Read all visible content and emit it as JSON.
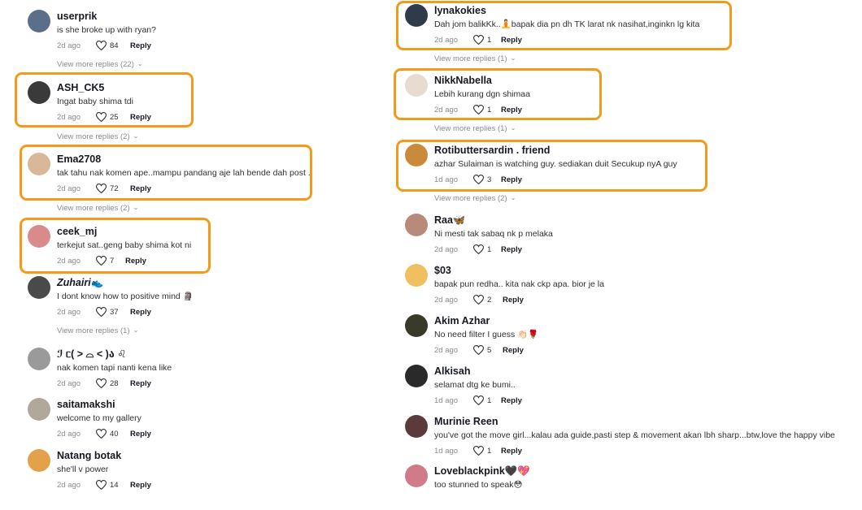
{
  "colors": {
    "highlight": "#f39a1c",
    "muted": "#8a8b91",
    "text": "#161823"
  },
  "left": {
    "comments": [
      {
        "user": "userprik",
        "text": "is she broke up with ryan?",
        "time": "2d ago",
        "likes": "84",
        "reply": "Reply",
        "avatar": "#5b6f8a"
      },
      {
        "user": "ASH_CK5",
        "text": "Ingat baby shima tdi",
        "time": "2d ago",
        "likes": "25",
        "reply": "Reply",
        "avatar": "#3a3a3a"
      },
      {
        "user": "Ema2708",
        "text": "tak tahu nak komen ape..mampu pandang aje lah bende dah post .",
        "time": "2d ago",
        "likes": "72",
        "reply": "Reply",
        "avatar": "#d9b89a"
      },
      {
        "user": "ceek_mj",
        "text": "terkejut sat..geng baby shima kot ni",
        "time": "2d ago",
        "likes": "7",
        "reply": "Reply",
        "avatar": "#d98a8a"
      },
      {
        "user": "Zuhairi👟",
        "text": "I dont know how to positive mind 🗿",
        "time": "2d ago",
        "likes": "37",
        "reply": "Reply",
        "avatar": "#4a4a4a"
      },
      {
        "user": "ℐ ᥴ( > ⌓ < )ა ♌",
        "text": "nak komen tapi nanti kena like",
        "time": "2d ago",
        "likes": "28",
        "reply": "Reply",
        "avatar": "#9a9a9a"
      },
      {
        "user": "saitamakshi",
        "text": "welcome to my gallery",
        "time": "2d ago",
        "likes": "40",
        "reply": "Reply",
        "avatar": "#b0a89a"
      },
      {
        "user": "Natang botak",
        "text": "she'll v power",
        "time": "2d ago",
        "likes": "14",
        "reply": "Reply",
        "avatar": "#e3a24a"
      }
    ],
    "view_more": [
      "View more replies (22)",
      "View more replies (2)",
      "View more replies (2)",
      "View more replies (1)"
    ]
  },
  "right": {
    "comments": [
      {
        "user": "lynakokies",
        "text": "Dah jom balikKk..🧘bapak dia pn dh TK larat nk nasihat,inginkn lg kita",
        "time": "2d ago",
        "likes": "1",
        "reply": "Reply",
        "avatar": "#2f3a4a"
      },
      {
        "user": "NikkNabella",
        "text": "Lebih kurang dgn shimaa",
        "time": "2d ago",
        "likes": "1",
        "reply": "Reply",
        "avatar": "#e8dcd0"
      },
      {
        "user": "Rotibuttersardin . friend",
        "text": "azhar Sulaiman is watching guy. sediakan duit Secukup nyA guy",
        "time": "1d ago",
        "likes": "3",
        "reply": "Reply",
        "avatar": "#c98a3a"
      },
      {
        "user": "Raa🦋",
        "text": "Ni mesti tak sabaq nk p melaka",
        "time": "2d ago",
        "likes": "1",
        "reply": "Reply",
        "avatar": "#b88a7a"
      },
      {
        "user": "$03",
        "text": "bapak pun redha.. kita nak ckp apa. bior je la",
        "time": "2d ago",
        "likes": "2",
        "reply": "Reply",
        "avatar": "#f0c060"
      },
      {
        "user": "Akim Azhar",
        "text": "No need filter I guess 👏🏻🌹",
        "time": "2d ago",
        "likes": "5",
        "reply": "Reply",
        "avatar": "#3a3a2a"
      },
      {
        "user": "Alkisah",
        "text": "selamat dtg ke bumi..",
        "time": "1d ago",
        "likes": "1",
        "reply": "Reply",
        "avatar": "#2a2a2a"
      },
      {
        "user": "Murinie Reen",
        "text": "you've got the move girl...kalau ada guide,pasti step & movement akan lbh sharp...btw,love the happy vibe",
        "time": "1d ago",
        "likes": "1",
        "reply": "Reply",
        "avatar": "#5a3a3a"
      },
      {
        "user": "Loveblackpink🖤💖",
        "text": "too stunned to speak😳",
        "time": "",
        "likes": "",
        "reply": "",
        "avatar": "#d07a8a"
      }
    ],
    "view_more": [
      "View more replies (1)",
      "View more replies (1)",
      "View more replies (2)"
    ]
  }
}
